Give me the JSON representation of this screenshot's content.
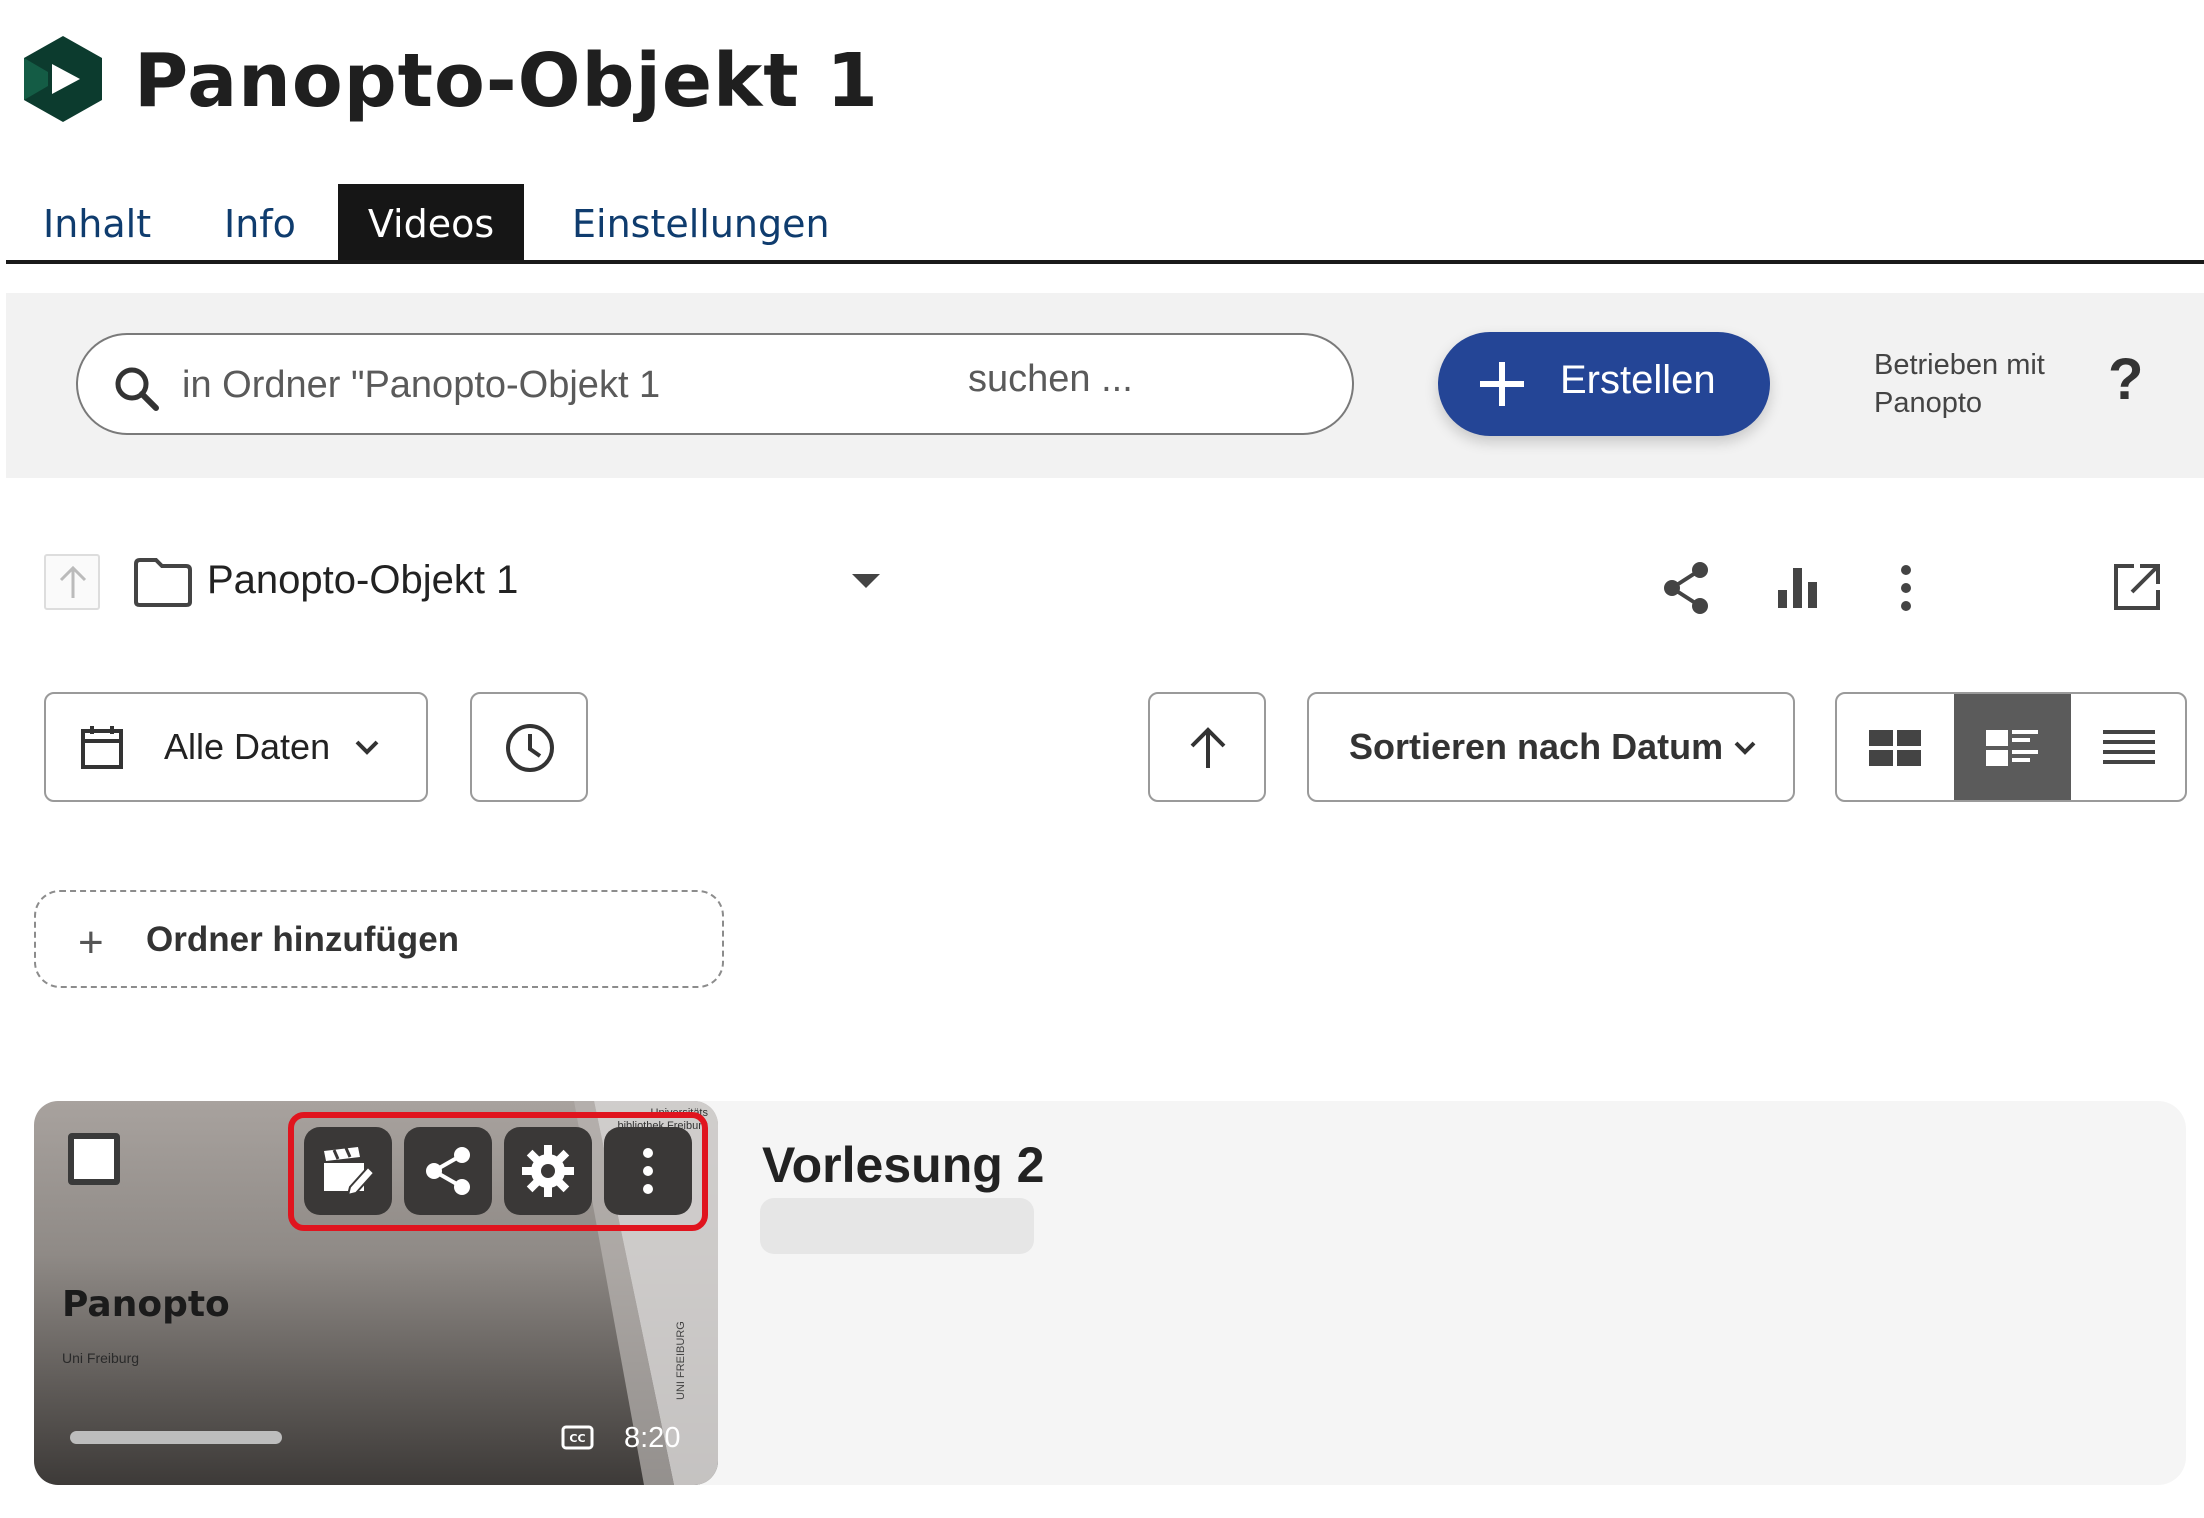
{
  "header": {
    "title": "Panopto-Objekt 1",
    "logo_icon": "panopto-logo-icon"
  },
  "tabs": [
    {
      "label": "Inhalt",
      "active": false
    },
    {
      "label": "Info",
      "active": false
    },
    {
      "label": "Videos",
      "active": true
    },
    {
      "label": "Einstellungen",
      "active": false
    }
  ],
  "toolbar": {
    "search_placeholder": "in Ordner \"Panopto-Objekt 1",
    "search_suffix": "suchen ...",
    "create_label": "Erstellen",
    "powered_line1": "Betrieben mit",
    "powered_line2": "Panopto",
    "help_label": "?"
  },
  "folder": {
    "name": "Panopto-Objekt 1",
    "icons": [
      "arrow-up-icon",
      "folder-icon",
      "dropdown-caret-icon",
      "share-icon",
      "stats-icon",
      "more-vertical-icon",
      "open-external-icon"
    ]
  },
  "filters": {
    "date_label": "Alle Daten",
    "sort_label": "Sortieren nach Datum",
    "view_modes": [
      "grid-view-icon",
      "detail-view-icon",
      "list-view-icon"
    ],
    "active_view": "detail-view-icon"
  },
  "add_folder": {
    "label": "Ordner hinzufügen"
  },
  "video": {
    "title": "Vorlesung 2",
    "thumbnail_title": "Panopto",
    "thumbnail_subtitle": "Uni Freiburg",
    "duration": "8:20",
    "thumbnail_brand_top": "Universitäts bibliothek Freiburg",
    "thumbnail_brand_side": "UNI FREIBURG",
    "actions": [
      "edit-video-icon",
      "share-icon",
      "settings-icon",
      "more-vertical-icon"
    ],
    "highlight_color": "#e0141e"
  },
  "colors": {
    "accent": "#244596",
    "tab_active_bg": "#161616",
    "tab_text": "#0f3c6e"
  }
}
